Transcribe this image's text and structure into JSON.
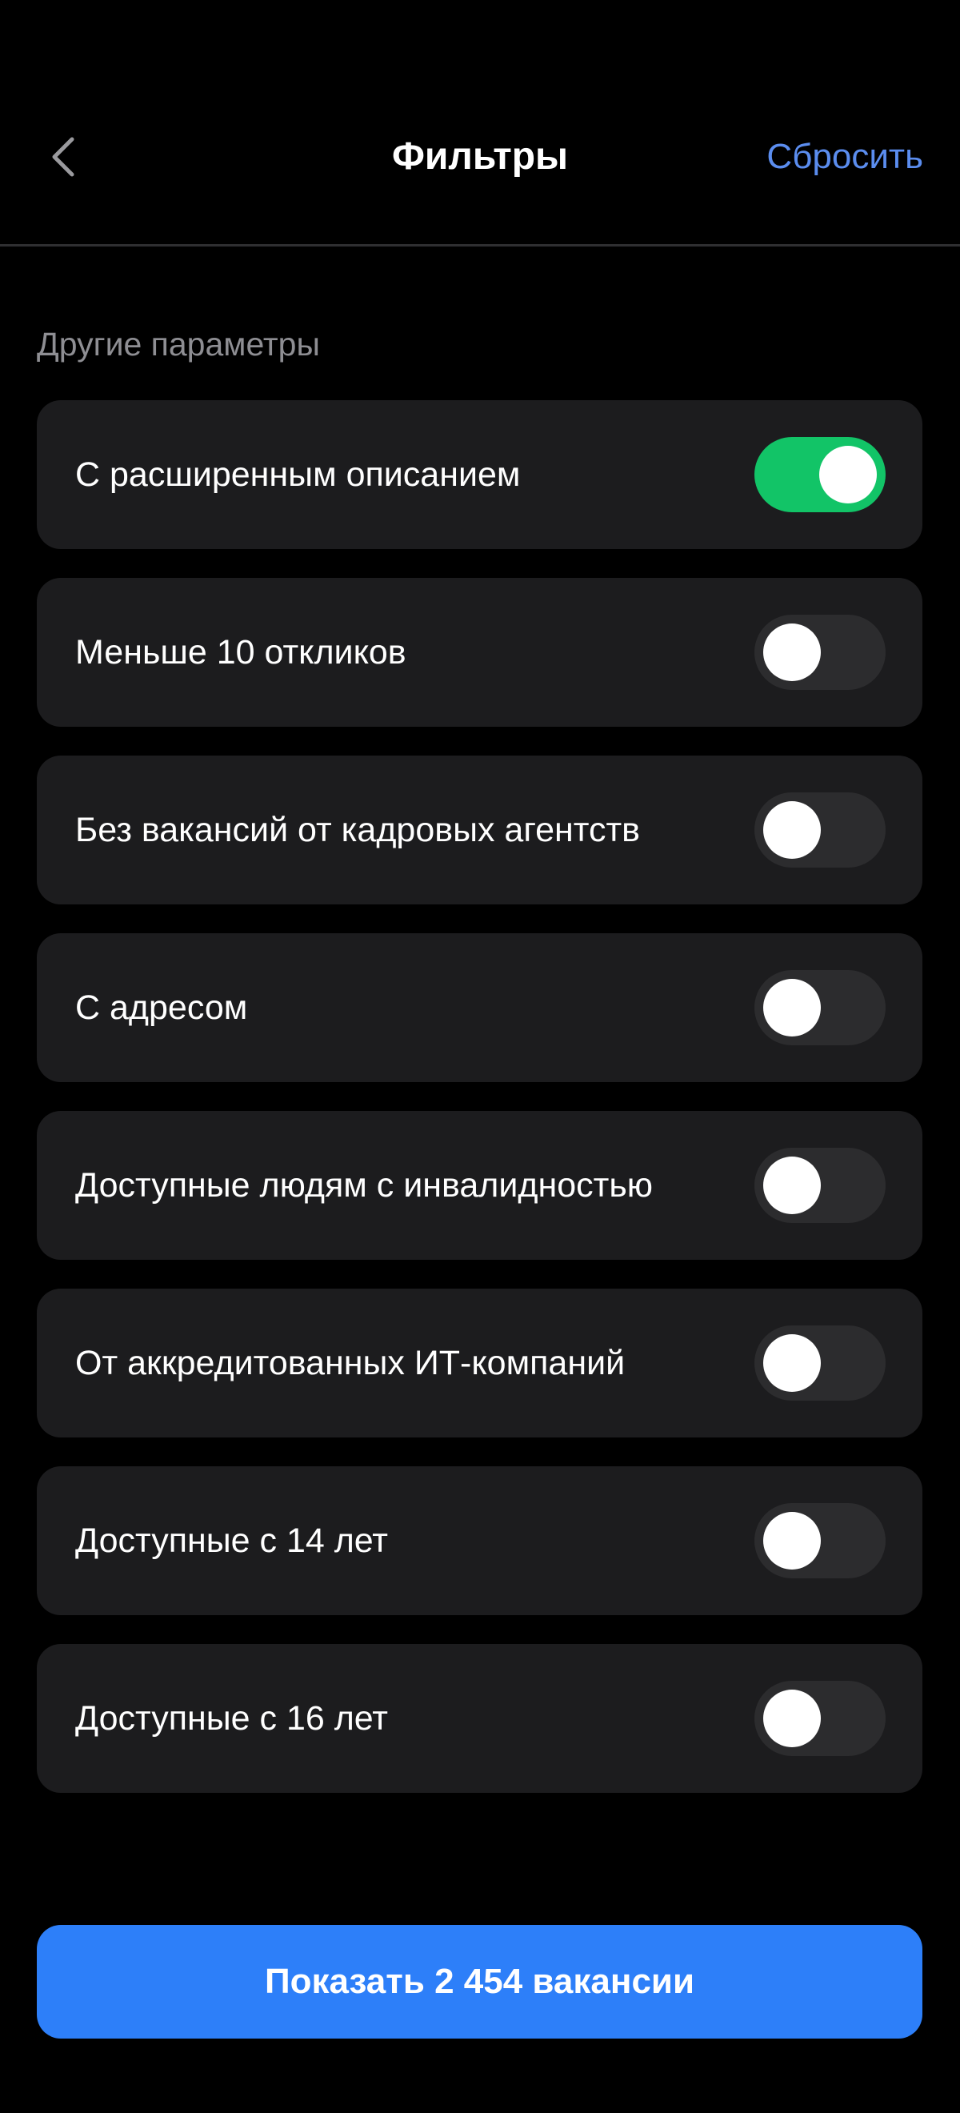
{
  "header": {
    "title": "Фильтры",
    "back_icon": "chevron-left-icon",
    "reset_label": "Сбросить",
    "reset_color": "#5b8def"
  },
  "section": {
    "title": "Другие параметры"
  },
  "filters": [
    {
      "label": "С расширенным описанием",
      "enabled": true
    },
    {
      "label": "Меньше 10 откликов",
      "enabled": false
    },
    {
      "label": "Без вакансий от кадровых агентств",
      "enabled": false
    },
    {
      "label": "С адресом",
      "enabled": false
    },
    {
      "label": "Доступные людям с инвалидностью",
      "enabled": false
    },
    {
      "label": "От аккредитованных ИТ-компаний",
      "enabled": false
    },
    {
      "label": "Доступные с 14 лет",
      "enabled": false
    },
    {
      "label": "Доступные с 16 лет",
      "enabled": false
    }
  ],
  "footer": {
    "show_button_label": "Показать 2 454 вакансии",
    "button_color": "#2d7ff9"
  },
  "colors": {
    "background": "#000000",
    "card": "#1c1c1e",
    "toggle_on": "#12c467",
    "toggle_off": "#2c2c2e"
  }
}
